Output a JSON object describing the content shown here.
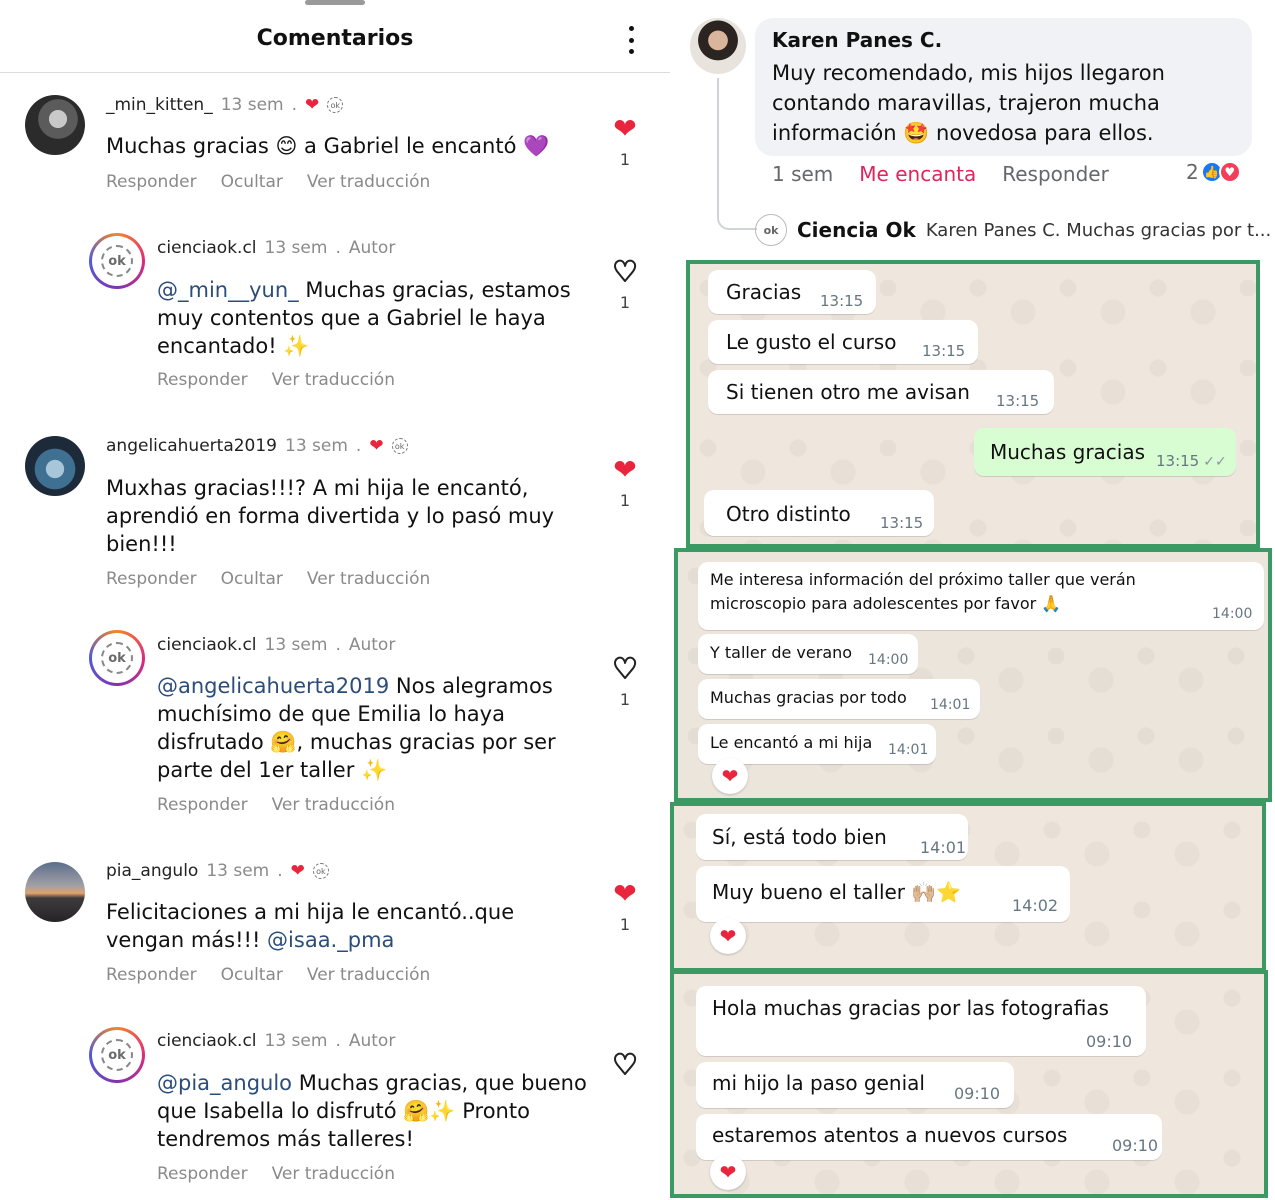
{
  "instagram": {
    "title": "Comentarios",
    "more_icon": "more-vertical-icon",
    "comments": [
      {
        "user": "_min_kitten_",
        "time": "13 sem",
        "dot": ".",
        "text": "Muchas gracias 😊 a Gabriel le encantó 💜",
        "actions": [
          "Responder",
          "Ocultar",
          "Ver traducción"
        ],
        "likes": "1",
        "liked": true
      },
      {
        "user": "cienciaok.cl",
        "time": "13 sem",
        "dot": ".",
        "tag": "Autor",
        "mention": "@_min__yun_",
        "text": " Muchas gracias, estamos muy contentos que a Gabriel le haya encantado! ✨",
        "actions": [
          "Responder",
          "Ver traducción"
        ],
        "likes": "1",
        "liked": false
      },
      {
        "user": "angelicahuerta2019",
        "time": "13 sem",
        "dot": ".",
        "text": "Muxhas gracias!!!? A mi hija le encantó, aprendió en forma divertida y lo pasó muy bien!!!",
        "actions": [
          "Responder",
          "Ocultar",
          "Ver traducción"
        ],
        "likes": "1",
        "liked": true
      },
      {
        "user": "cienciaok.cl",
        "time": "13 sem",
        "dot": ".",
        "tag": "Autor",
        "mention": "@angelicahuerta2019",
        "text": " Nos alegramos muchísimo de que Emilia lo haya disfrutado 🤗, muchas gracias por ser parte del 1er taller ✨",
        "actions": [
          "Responder",
          "Ver traducción"
        ],
        "likes": "1",
        "liked": false
      },
      {
        "user": "pia_angulo",
        "time": "13 sem",
        "dot": ".",
        "text": "Felicitaciones a mi hija le encantó..que vengan más!!! ",
        "mention_after": "@isaa._pma",
        "actions": [
          "Responder",
          "Ocultar",
          "Ver traducción"
        ],
        "likes": "1",
        "liked": true
      },
      {
        "user": "cienciaok.cl",
        "time": "13 sem",
        "dot": ".",
        "tag": "Autor",
        "mention": "@pia_angulo",
        "text": " Muchas gracias, que bueno que Isabella lo disfrutó 🤗✨ Pronto tendremos más talleres!",
        "actions": [
          "Responder",
          "Ver traducción"
        ],
        "likes": "",
        "liked": false
      }
    ]
  },
  "facebook": {
    "author": "Karen Panes C.",
    "text": "Muy recomendado, mis hijos llegaron contando maravillas, trajeron mucha información 🤩 novedosa para ellos.",
    "time": "1 sem",
    "love_label": "Me encanta",
    "reply_label": "Responder",
    "reaction_count": "2",
    "reply_author": "Ciencia Ok",
    "reply_preview": "Karen Panes C. Muchas gracias por t..."
  },
  "whatsapp": {
    "panel1": [
      {
        "text": "Gracias",
        "time": "13:15",
        "dir": "in"
      },
      {
        "text": "Le gusto el curso",
        "time": "13:15",
        "dir": "in"
      },
      {
        "text": "Si tienen otro me avisan",
        "time": "13:15",
        "dir": "in"
      },
      {
        "text": "Muchas gracias",
        "time": "13:15",
        "dir": "out"
      },
      {
        "text": "Otro distinto",
        "time": "13:15",
        "dir": "in"
      }
    ],
    "panel2": [
      {
        "text": "Me interesa información del próximo taller que verán",
        "text2": "microscopio para adolescentes por favor 🙏",
        "time": "14:00"
      },
      {
        "text": "Y taller de verano",
        "time": "14:00"
      },
      {
        "text": "Muchas gracias por todo",
        "time": "14:01"
      },
      {
        "text": "Le encantó a mi hija",
        "time": "14:01"
      }
    ],
    "panel3": [
      {
        "text": "Sí, está todo bien",
        "time": "14:01"
      },
      {
        "text": "Muy bueno el taller 🙌🏼⭐",
        "time": "14:02"
      }
    ],
    "panel4": [
      {
        "text": "Hola muchas gracias por las fotografias",
        "time": "09:10"
      },
      {
        "text": "mi hijo la paso genial",
        "time": "09:10"
      },
      {
        "text": "estaremos atentos a nuevos cursos",
        "time": "09:10"
      }
    ],
    "reaction": "❤"
  },
  "colors": {
    "accent_green": "#3b9a63",
    "heart_red": "#e8253d",
    "fb_love": "#e0245e",
    "fb_blue": "#1877f2",
    "wa_out": "#d9fdd3"
  }
}
